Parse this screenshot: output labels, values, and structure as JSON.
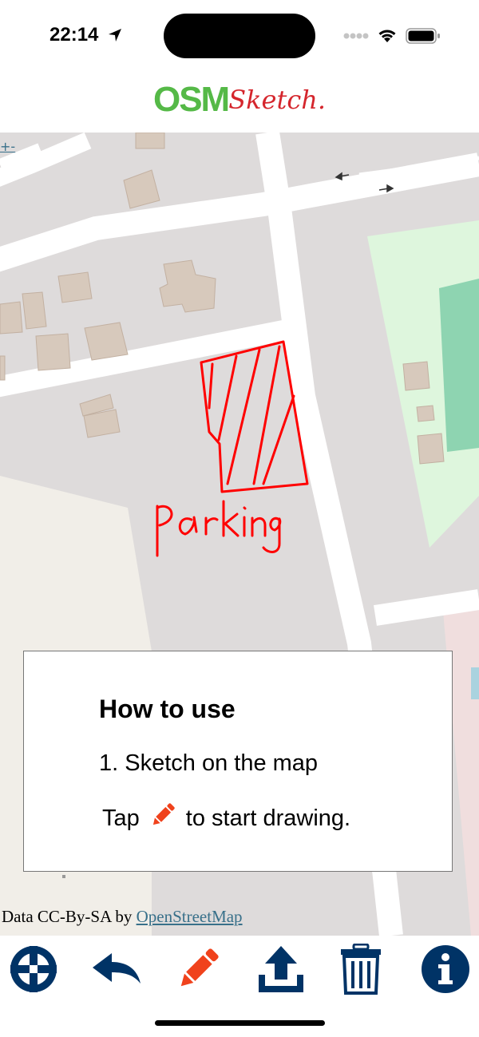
{
  "status_bar": {
    "time": "22:14"
  },
  "logo": {
    "osm": "OSM",
    "sketch": "Sketch."
  },
  "map": {
    "zoom_control": "+-",
    "sketch_label": "parking",
    "attribution": {
      "prefix": "Data CC-By-SA by ",
      "link": "OpenStreetMap"
    }
  },
  "dialog": {
    "title": "How to use",
    "step": "1. Sketch on the map",
    "tap_before": "Tap",
    "tap_after": "to start drawing."
  },
  "toolbar": {
    "buttons": [
      "locate-icon",
      "undo-icon",
      "pencil-icon",
      "upload-icon",
      "trash-icon",
      "info-icon"
    ]
  },
  "colors": {
    "accent": "#003366",
    "draw": "#ff0000",
    "pencil": "#f0421c",
    "brand_green": "#55b947",
    "brand_red": "#d5262d"
  }
}
